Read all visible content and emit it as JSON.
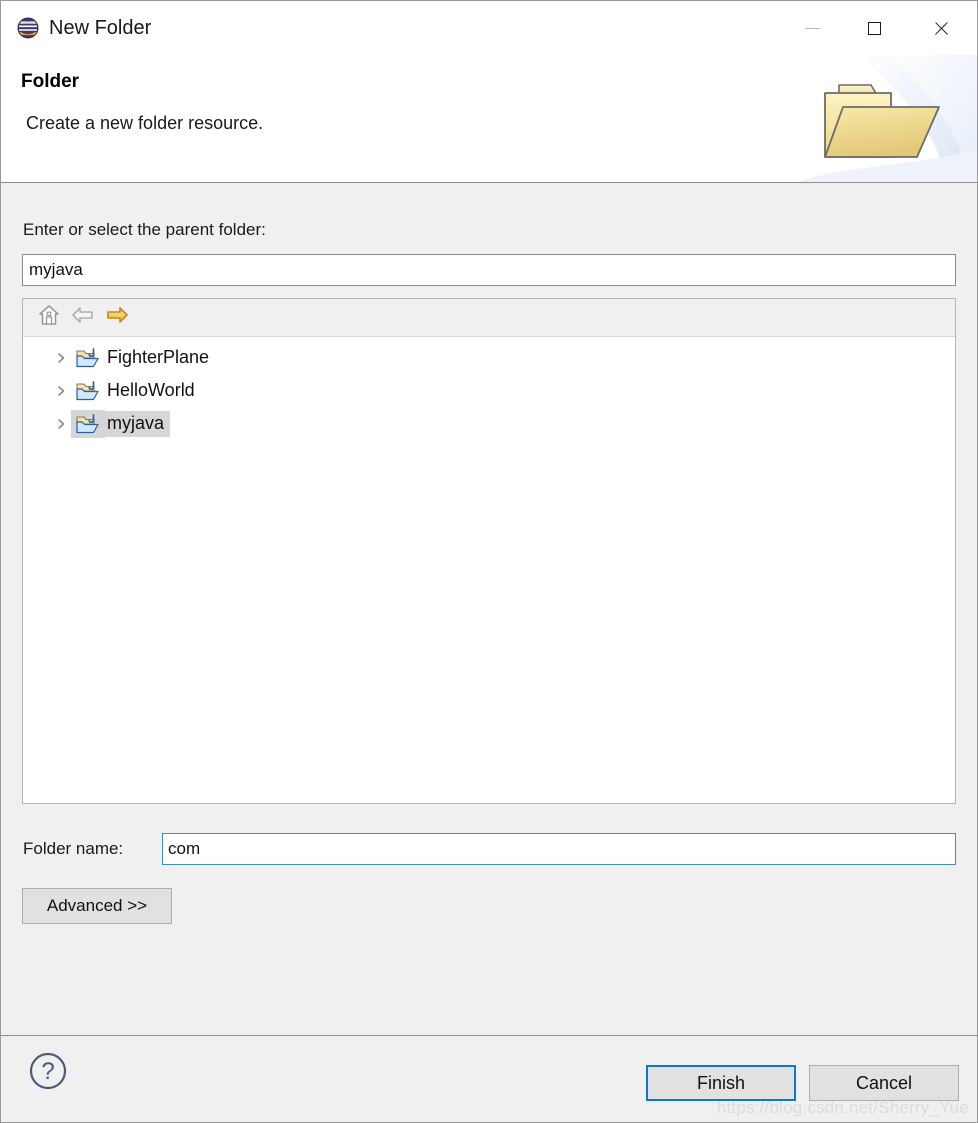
{
  "window": {
    "title": "New Folder",
    "app_icon": "eclipse-logo-icon",
    "controls": {
      "minimize": "minimize-icon",
      "maximize": "maximize-icon",
      "close": "close-icon"
    }
  },
  "header": {
    "title": "Folder",
    "description": "Create a new folder resource.",
    "banner_icon": "open-folder-banner-icon"
  },
  "form": {
    "parent_label": "Enter or select the parent folder:",
    "parent_value": "myjava",
    "parent_placeholder": "",
    "folder_name_label": "Folder name:",
    "folder_name_value": "com",
    "folder_name_placeholder": "",
    "advanced_label": "Advanced >>"
  },
  "tree": {
    "toolbar": [
      {
        "name": "home-icon",
        "enabled": false
      },
      {
        "name": "back-arrow-icon",
        "enabled": false
      },
      {
        "name": "forward-arrow-icon",
        "enabled": true
      }
    ],
    "items": [
      {
        "label": "FighterPlane",
        "icon": "java-project-folder-icon",
        "expanded": false,
        "selected": false
      },
      {
        "label": "HelloWorld",
        "icon": "java-project-folder-icon",
        "expanded": false,
        "selected": false
      },
      {
        "label": "myjava",
        "icon": "java-project-folder-icon",
        "expanded": false,
        "selected": true
      }
    ]
  },
  "footer": {
    "help_icon": "help-question-icon",
    "finish_label": "Finish",
    "cancel_label": "Cancel",
    "watermark": "https://blog.csdn.net/Sherry_Yue"
  },
  "colors": {
    "dialog_background": "#f0f0f0",
    "panel_white": "#ffffff",
    "accent_focus_blue": "#0a78d4",
    "selection_gray": "#d6d6d6",
    "arrow_orange": "#e8a317",
    "help_icon_blue": "#4a5a78"
  }
}
